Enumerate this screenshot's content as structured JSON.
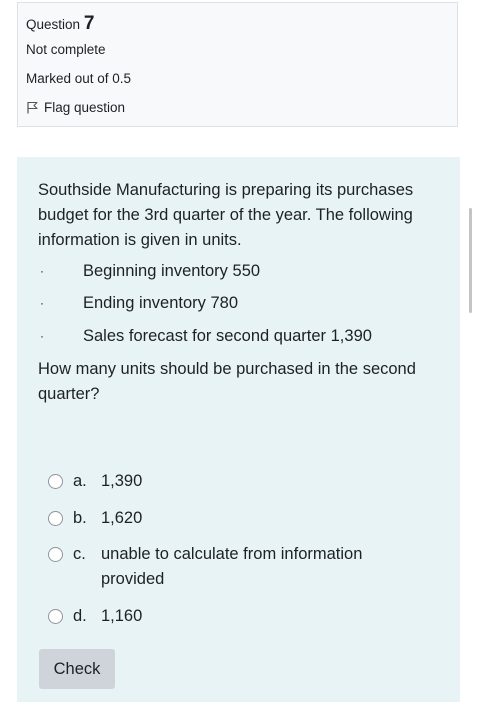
{
  "info": {
    "question_label": "Question",
    "question_number": "7",
    "state": "Not complete",
    "grade": "Marked out of 0.5",
    "flag_label": "Flag question"
  },
  "question": {
    "text": "Southside Manufacturing is preparing its purchases budget for the 3rd quarter of the year. The following information is given in units.",
    "bullets": [
      {
        "marker": "·",
        "text": "Beginning inventory 550"
      },
      {
        "marker": "·",
        "text": "Ending inventory 780"
      },
      {
        "marker": "·",
        "text": "Sales forecast for second quarter 1,390"
      }
    ],
    "prompt": "How many units should be purchased in the second quarter?"
  },
  "answers": [
    {
      "letter": "a.",
      "text": "1,390"
    },
    {
      "letter": "b.",
      "text": "1,620"
    },
    {
      "letter": "c.",
      "text": "unable to calculate from information provided"
    },
    {
      "letter": "d.",
      "text": "1,160"
    }
  ],
  "check_label": "Check",
  "colors": {
    "formulation_bg": "#e7f3f5",
    "info_bg": "#f8f9fa",
    "button_bg": "#ced4da"
  },
  "icons": {
    "flag": "flag-icon",
    "radio": "radio-icon"
  }
}
